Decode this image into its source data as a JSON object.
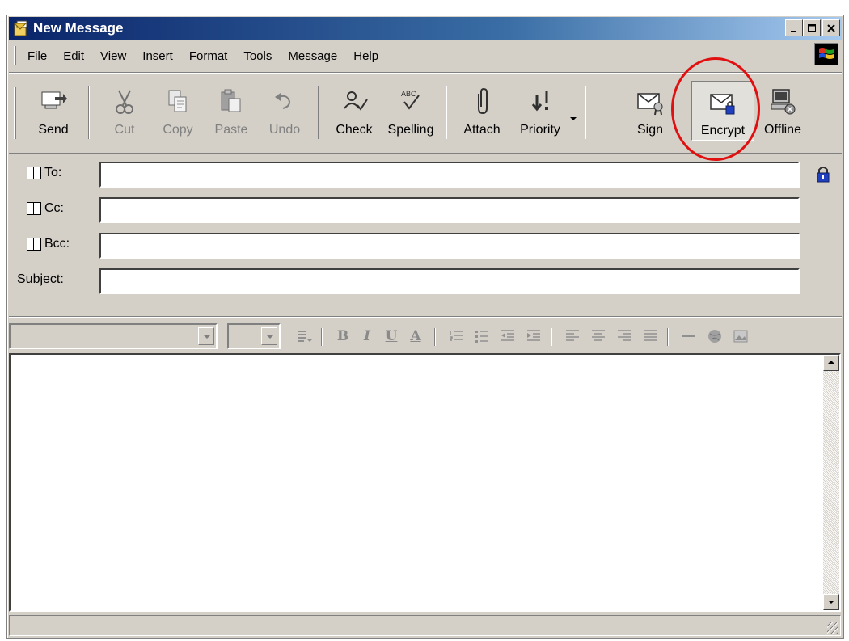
{
  "window": {
    "title": "New Message"
  },
  "menu": {
    "items": [
      {
        "label": "File",
        "key": "F",
        "rest": "ile"
      },
      {
        "label": "Edit",
        "key": "E",
        "rest": "dit"
      },
      {
        "label": "View",
        "key": "V",
        "rest": "iew"
      },
      {
        "label": "Insert",
        "key": "I",
        "rest": "nsert"
      },
      {
        "label": "Format",
        "pre": "F",
        "key": "o",
        "rest": "rmat"
      },
      {
        "label": "Tools",
        "key": "T",
        "rest": "ools"
      },
      {
        "label": "Message",
        "key": "M",
        "rest": "essage"
      },
      {
        "label": "Help",
        "key": "H",
        "rest": "elp"
      }
    ]
  },
  "toolbar": {
    "send": "Send",
    "cut": "Cut",
    "copy": "Copy",
    "paste": "Paste",
    "undo": "Undo",
    "check": "Check",
    "spelling": "Spelling",
    "attach": "Attach",
    "priority": "Priority",
    "sign": "Sign",
    "encrypt": "Encrypt",
    "offline": "Offline",
    "spelling_badge": "ABC"
  },
  "fields": {
    "to_label": "To:",
    "cc_label": "Cc:",
    "bcc_label": "Bcc:",
    "subject_label": "Subject:",
    "to_value": "",
    "cc_value": "",
    "bcc_value": "",
    "subject_value": ""
  },
  "format": {
    "bold": "B",
    "italic": "I",
    "underline": "U",
    "font_color": "A"
  },
  "colors": {
    "title_start": "#0a246a",
    "title_end": "#a6caf0",
    "highlight": "#e01010",
    "chrome": "#d4d0c8"
  }
}
